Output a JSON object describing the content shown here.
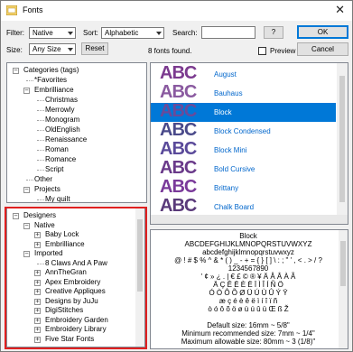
{
  "window": {
    "title": "Fonts",
    "close_glyph": "✕"
  },
  "filter": {
    "label": "Filter:",
    "value": "Native"
  },
  "sort": {
    "label": "Sort:",
    "value": "Alphabetic"
  },
  "search": {
    "label": "Search:",
    "value": "",
    "help_label": "?"
  },
  "size": {
    "label": "Size:",
    "value": "Any Size"
  },
  "reset_label": "Reset",
  "found_text": "8 fonts found.",
  "preview_checkbox_label": "Preview",
  "ok_label": "OK",
  "cancel_label": "Cancel",
  "categories_tree": [
    {
      "label": "Categories (tags)",
      "level": 0,
      "expander": "−"
    },
    {
      "label": "*Favorites",
      "level": 1
    },
    {
      "label": "Embrilliance",
      "level": 1,
      "expander": "−"
    },
    {
      "label": "Christmas",
      "level": 2
    },
    {
      "label": "Merrowly",
      "level": 2
    },
    {
      "label": "Monogram",
      "level": 2
    },
    {
      "label": "OldEnglish",
      "level": 2
    },
    {
      "label": "Renaissance",
      "level": 2
    },
    {
      "label": "Roman",
      "level": 2
    },
    {
      "label": "Romance",
      "level": 2
    },
    {
      "label": "Script",
      "level": 2
    },
    {
      "label": "Other",
      "level": 1
    },
    {
      "label": "Projects",
      "level": 1,
      "expander": "−"
    },
    {
      "label": "My quilt",
      "level": 2
    }
  ],
  "fonts": [
    {
      "name": "August",
      "sample": "ABC",
      "color": "#7b3a8f",
      "selected": false
    },
    {
      "name": "Bauhaus",
      "sample": "ABC",
      "color": "#8a5aa0",
      "selected": false
    },
    {
      "name": "Block",
      "sample": "ABC",
      "color": "#6a4a9a",
      "selected": true
    },
    {
      "name": "Block Condensed",
      "sample": "ABC",
      "color": "#4a4a8a",
      "selected": false
    },
    {
      "name": "Block Mini",
      "sample": "ABC",
      "color": "#5a4a9a",
      "selected": false
    },
    {
      "name": "Bold Cursive",
      "sample": "ABC",
      "color": "#6a3a8a",
      "selected": false
    },
    {
      "name": "Brittany",
      "sample": "ABC",
      "color": "#7a3a9a",
      "selected": false
    },
    {
      "name": "Chalk Board",
      "sample": "ABC",
      "color": "#5a3a7a",
      "selected": false
    }
  ],
  "preview": {
    "lines": [
      "Block",
      "ABCDEFGHIJKLMNOPQRSTUVWXYZ",
      "abcdefghijklmnopqrstuvwxyz",
      "@ ! # $ % ^ & * ( ) _ - + = { } [ ] \\ : ; \" ' , < . > / ?",
      "1234567890",
      "' ¢ » ¿ . | € £ © ® ¥ Ä Å Â À Ã",
      "Ä Ç Ê Ë È Ë Ï Ì Î Í Ñ Ö",
      "Ó Ò Ô Õ Ø Ü Ú Ù Û Ý Ÿ",
      "æ ç é è ê ë ì í î ï ñ",
      "ò ó ô õ ö ø ù ú û ü Œ ß Ž",
      "",
      "Default size:  16mm ~ 5/8\"",
      "Minimum recommended size:  7mm ~ 1/4\"",
      "Maximum allowable size:  80mm ~ 3 (1/8)\""
    ]
  },
  "designers_tree": [
    {
      "label": "Designers",
      "level": 0,
      "expander": "−"
    },
    {
      "label": "Native",
      "level": 1,
      "expander": "−"
    },
    {
      "label": "Baby Lock",
      "level": 2,
      "expander": "+"
    },
    {
      "label": "Embrilliance",
      "level": 2,
      "expander": "+"
    },
    {
      "label": "Imported",
      "level": 1,
      "expander": "−"
    },
    {
      "label": "8 Claws And A Paw",
      "level": 2
    },
    {
      "label": "AnnTheGran",
      "level": 2,
      "expander": "+"
    },
    {
      "label": "Apex Embroidery",
      "level": 2,
      "expander": "+"
    },
    {
      "label": "Creative Appliques",
      "level": 2,
      "expander": "+"
    },
    {
      "label": "Designs by JuJu",
      "level": 2,
      "expander": "+"
    },
    {
      "label": "DigiStitches",
      "level": 2,
      "expander": "+"
    },
    {
      "label": "Embroidery Garden",
      "level": 2,
      "expander": "+"
    },
    {
      "label": "Embroidery Library",
      "level": 2,
      "expander": "+"
    },
    {
      "label": "Five Star Fonts",
      "level": 2,
      "expander": "+"
    }
  ],
  "colors": {
    "accent": "#0078d7",
    "highlight_box": "#e02020",
    "font_link": "#0066cc"
  }
}
